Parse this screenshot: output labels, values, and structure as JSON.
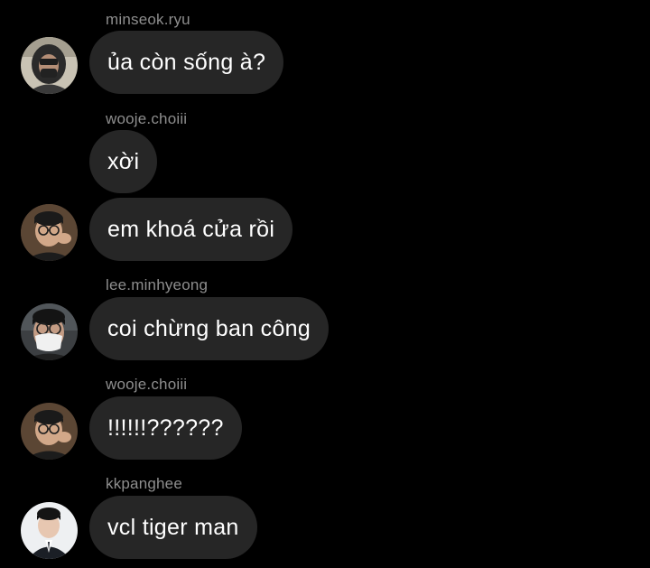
{
  "messages": [
    {
      "sender": "minseok.ryu",
      "text": "ủa còn sống à?",
      "avatar_icon": "hooded-person-avatar"
    },
    {
      "sender": "wooje.choiii",
      "text": "xời"
    },
    {
      "text": "em khoá cửa rồi",
      "avatar_icon": "glasses-person-avatar"
    },
    {
      "sender": "lee.minhyeong",
      "text": "coi chừng ban công",
      "avatar_icon": "masked-person-avatar"
    },
    {
      "sender": "wooje.choiii",
      "text": "!!!!!!??????",
      "avatar_icon": "glasses-person-avatar"
    },
    {
      "sender": "kkpanghee",
      "text": "vcl tiger man",
      "avatar_icon": "suited-person-avatar"
    }
  ],
  "colors": {
    "background": "#000000",
    "bubble": "#262626",
    "message_text": "#ffffff",
    "sender_name": "#8e8e8e"
  }
}
